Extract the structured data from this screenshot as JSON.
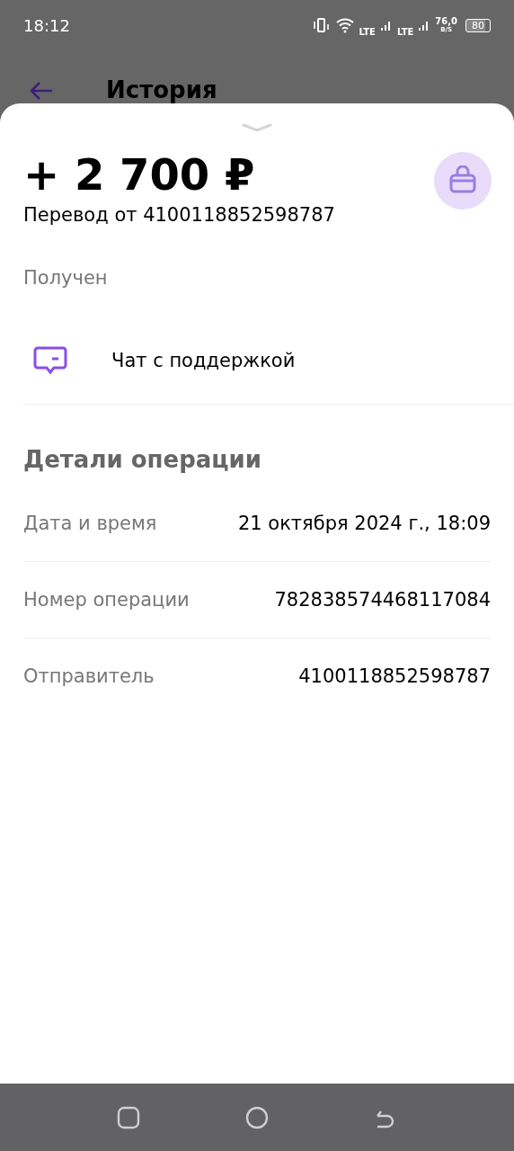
{
  "status_bar": {
    "time": "18:12",
    "network_1": "LTE",
    "network_2": "LTE",
    "speed": "76,0",
    "speed_unit": "B/S",
    "battery": "80"
  },
  "header": {
    "title": "История"
  },
  "operation": {
    "amount": "+ 2 700 ₽",
    "description": "Перевод от 4100118852598787",
    "status": "Получен"
  },
  "support": {
    "label": "Чат с поддержкой"
  },
  "details": {
    "title": "Детали операции",
    "rows": [
      {
        "label": "Дата и время",
        "value": "21 октября 2024 г., 18:09"
      },
      {
        "label": "Номер операции",
        "value": "782838574468117084"
      },
      {
        "label": "Отправитель",
        "value": "4100118852598787"
      }
    ]
  }
}
